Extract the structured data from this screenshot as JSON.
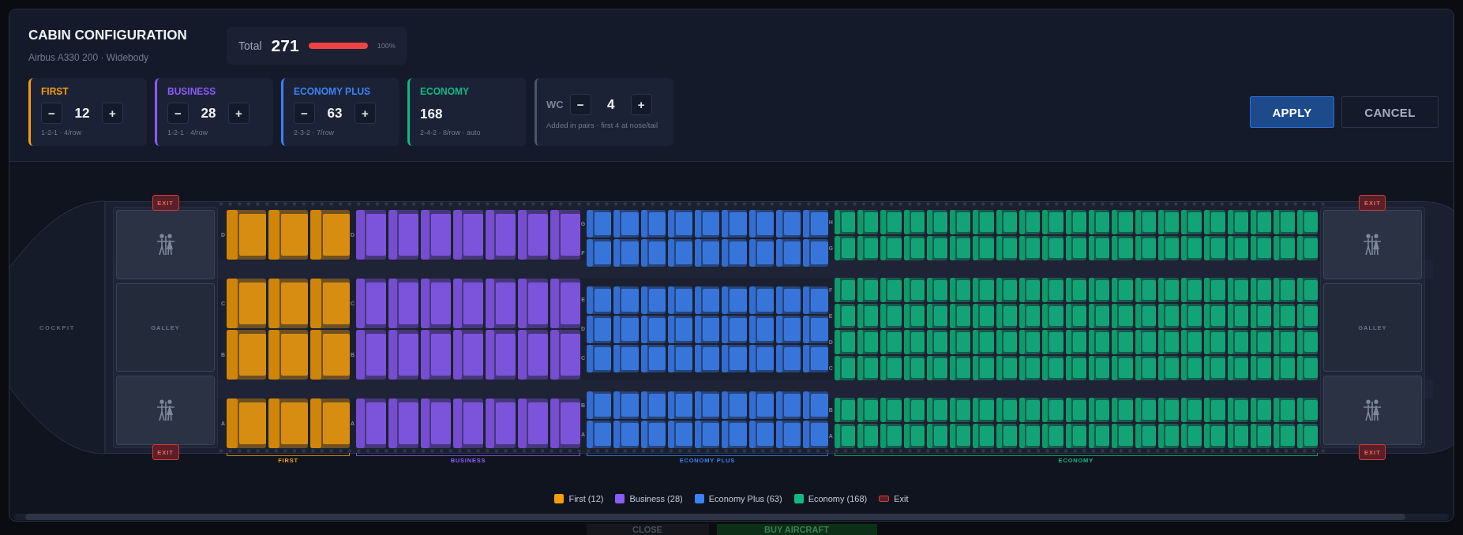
{
  "page_behind": {
    "buttons": [
      {
        "label": "CLOSE",
        "kind": "secondary"
      },
      {
        "label": "BUY AIRCRAFT",
        "kind": "primary"
      }
    ]
  },
  "dialog": {
    "title": "CABIN CONFIGURATION",
    "subtitle": "Airbus A330 200 · Widebody",
    "total": {
      "label": "Total",
      "value": "271",
      "level": 1,
      "percent": "100%"
    },
    "classes": [
      {
        "kind": "stepper",
        "label": "FIRST",
        "color": "#f59e0b",
        "value": "12",
        "layout": "1-2-1 · 4/row",
        "decrement": "−",
        "increment": "+"
      },
      {
        "kind": "stepper",
        "label": "BUSINESS",
        "color": "#8b5cf6",
        "value": "28",
        "layout": "1-2-1 · 4/row",
        "decrement": "−",
        "increment": "+"
      },
      {
        "kind": "stepper",
        "label": "ECONOMY PLUS",
        "color": "#3b82f6",
        "value": "63",
        "layout": "2-3-2 · 7/row",
        "decrement": "−",
        "increment": "+"
      },
      {
        "kind": "auto",
        "label": "ECONOMY",
        "color": "#10b981",
        "value": "168",
        "layout": "2-4-2 · 8/row · auto"
      }
    ],
    "wc": {
      "label": "WC",
      "value": "4",
      "note": "Added in pairs · first 4 at nose/tail",
      "decrement": "−",
      "increment": "+"
    },
    "actions": [
      {
        "label": "APPLY",
        "kind": "primary"
      },
      {
        "label": "CANCEL",
        "kind": "secondary"
      }
    ],
    "cabin": {
      "cockpit": "COCKPIT",
      "front": {
        "exits": [
          "EXIT",
          "EXIT"
        ],
        "galley": "GALLEY"
      },
      "sections": [
        {
          "kind": "first",
          "label": "FIRST",
          "blocks": [
            [
              "D"
            ],
            [
              "C",
              "B"
            ],
            [
              "A"
            ]
          ]
        },
        {
          "kind": "business",
          "label": "BUSINESS",
          "blocks": [
            [
              "D"
            ],
            [
              "C",
              "B"
            ],
            [
              "A"
            ]
          ]
        },
        {
          "kind": "premium",
          "label": "ECONOMY PLUS",
          "blocks": [
            [
              "G",
              "F"
            ],
            [
              "E",
              "D",
              "C"
            ],
            [
              "B",
              "A"
            ]
          ]
        },
        {
          "kind": "economy",
          "label": "ECONOMY",
          "blocks": [
            [
              "H",
              "G"
            ],
            [
              "F",
              "E",
              "D",
              "C"
            ],
            [
              "B",
              "A"
            ]
          ]
        }
      ],
      "rear": {
        "exits": [
          "EXIT",
          "EXIT"
        ],
        "galley": "GALLEY"
      }
    },
    "legend": [
      {
        "kind": "class",
        "label": "First (12)",
        "color": "#f59e0b"
      },
      {
        "kind": "class",
        "label": "Business (28)",
        "color": "#8b5cf6"
      },
      {
        "kind": "class",
        "label": "Economy Plus (63)",
        "color": "#3b82f6"
      },
      {
        "kind": "class",
        "label": "Economy (168)",
        "color": "#10b981"
      },
      {
        "kind": "exit",
        "label": "Exit"
      }
    ]
  }
}
